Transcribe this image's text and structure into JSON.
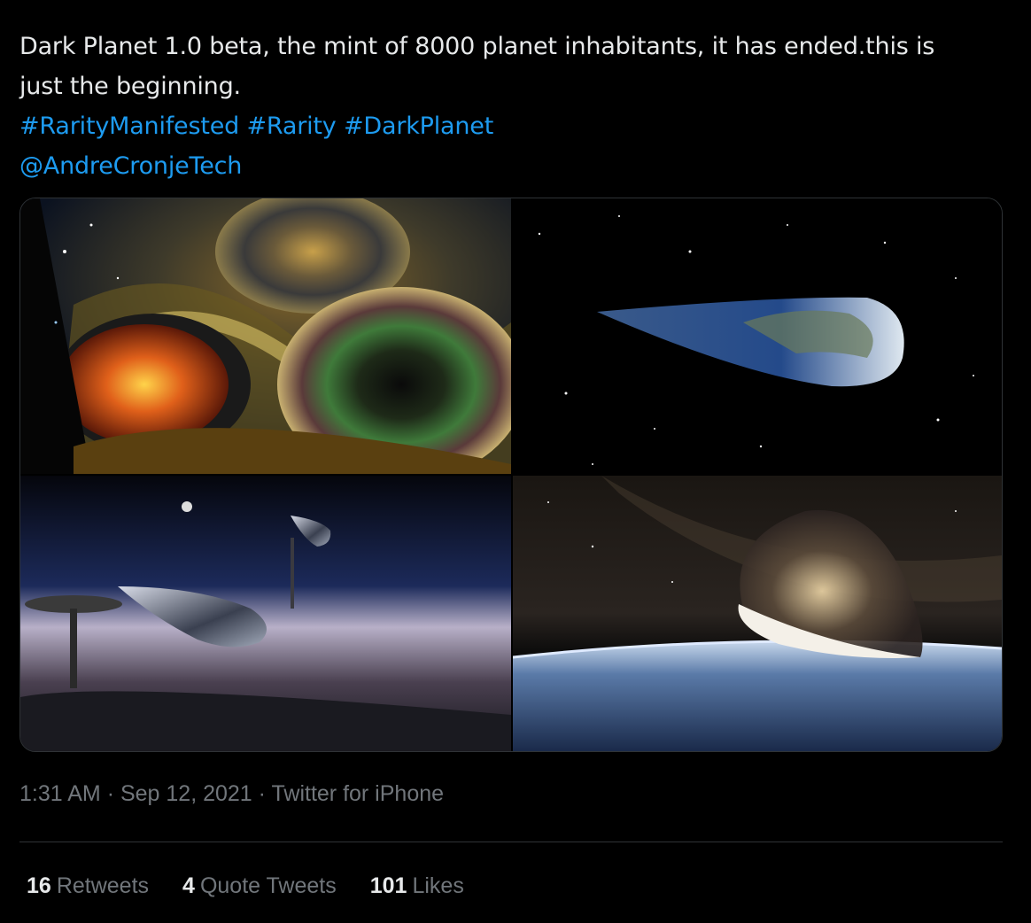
{
  "tweet": {
    "text_line1": "Dark Planet 1.0 beta, the mint of 8000 planet inhabitants, it has ended.this is",
    "text_line2": "just the beginning.",
    "hashtags": [
      "#RarityManifested",
      "#Rarity",
      "#DarkPlanet"
    ],
    "mention": "@AndreCronjeTech",
    "time": "1:31 AM",
    "date": "Sep 12, 2021",
    "source": "Twitter for iPhone",
    "separator": "·"
  },
  "stats": {
    "retweets": {
      "count": "16",
      "label": "Retweets"
    },
    "quotes": {
      "count": "4",
      "label": "Quote Tweets"
    },
    "likes": {
      "count": "101",
      "label": "Likes"
    }
  },
  "colors": {
    "background": "#000000",
    "text": "#e7e9ea",
    "link": "#1d9bf0",
    "muted": "#71767b",
    "border": "#2f3336"
  }
}
